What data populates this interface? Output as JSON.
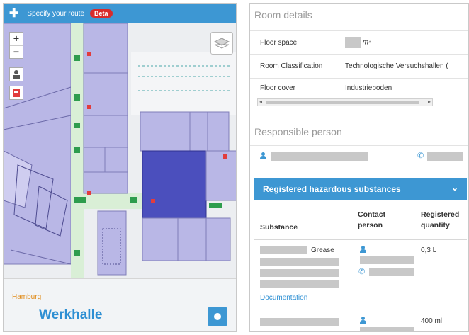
{
  "map": {
    "route_label": "Specify your route",
    "beta_badge": "Beta",
    "zoom_in": "+",
    "zoom_out": "−",
    "city": "Hamburg",
    "building_name": "Werkhalle",
    "icons": [
      "plus-icon",
      "person-icon",
      "escape-plan-icon",
      "layers-icon",
      "info-icon"
    ]
  },
  "room_details": {
    "title": "Room details",
    "rows": [
      {
        "label": "Floor space",
        "value": "",
        "unit": "m²"
      },
      {
        "label": "Room Classification",
        "value": "Technologische Versuchshallen ("
      },
      {
        "label": "Floor cover",
        "value": "Industrieboden"
      }
    ]
  },
  "responsible": {
    "title": "Responsible person"
  },
  "hazardous": {
    "title": "Registered hazardous substances",
    "columns": [
      "Substance",
      "Contact person",
      "Registered quantity"
    ],
    "rows": [
      {
        "substance_suffix": "Grease",
        "quantity": "0,3 L",
        "link": "Documentation"
      },
      {
        "substance_suffix": "",
        "quantity": "400 ml",
        "link": ""
      }
    ]
  },
  "colors": {
    "accent": "#3d97d3",
    "beta": "#d92b2b",
    "city": "#e08a17",
    "room_fill": "#b9b7e6",
    "room_selected": "#4b4fbd",
    "corridor": "#d9efd6"
  }
}
